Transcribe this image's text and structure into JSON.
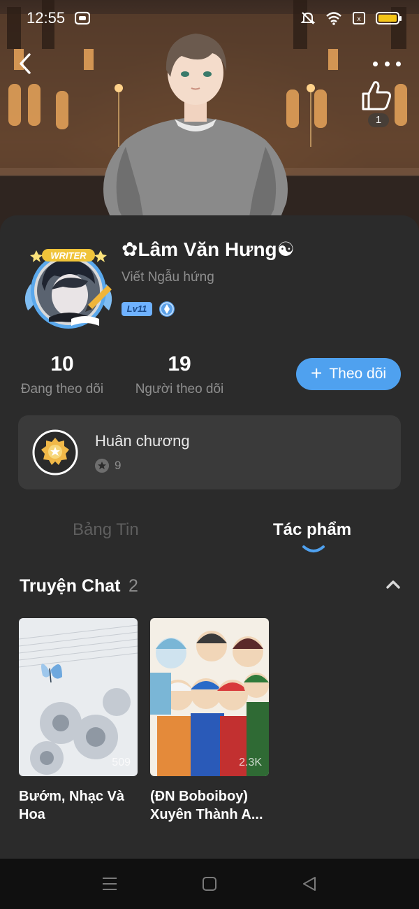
{
  "status_bar": {
    "time": "12:55",
    "icons": [
      "notification-app-icon",
      "mute-icon",
      "wifi-icon",
      "sim-icon",
      "battery-icon"
    ]
  },
  "header": {
    "like_count": "1",
    "icons": [
      "back-arrow-icon",
      "more-dots-icon",
      "thumbs-up-icon"
    ]
  },
  "profile": {
    "avatar_badge": "WRITER",
    "name": "✿Lâm Văn Hưng☯",
    "bio": "Viết Ngẫu hứng",
    "level": "Lv11",
    "stats": {
      "following_count": "10",
      "following_label": "Đang theo dõi",
      "followers_count": "19",
      "followers_label": "Người theo dõi"
    },
    "follow_button": {
      "icon": "+",
      "label": "Theo dõi"
    }
  },
  "medals": {
    "title": "Huân chương",
    "count": "9"
  },
  "tabs": [
    {
      "label": "Bảng Tin",
      "active": false
    },
    {
      "label": "Tác phẩm",
      "active": true
    }
  ],
  "section": {
    "title": "Truyện Chat",
    "count": "2"
  },
  "books": [
    {
      "title": "Bướm, Nhạc Và Hoa",
      "views": "509"
    },
    {
      "title": "(ĐN Boboiboy) Xuyên Thành A...",
      "views": "2.3K"
    }
  ],
  "nav_bar": {
    "icons": [
      "menu-lines-icon",
      "home-square-icon",
      "back-triangle-icon"
    ]
  },
  "colors": {
    "background": "#2b2b2b",
    "card": "#3a3a3a",
    "accent": "#4fa1ef",
    "muted_text": "#8e8e8e",
    "level_badge": "#6fb2ff"
  }
}
